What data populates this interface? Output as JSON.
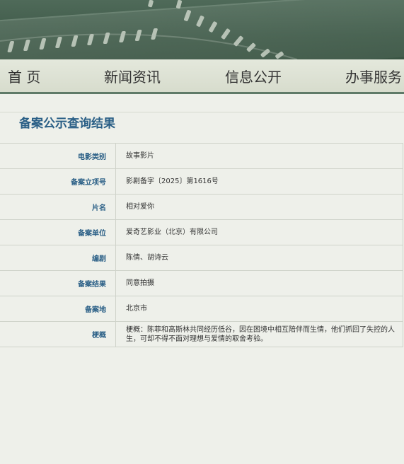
{
  "nav": {
    "items": [
      {
        "label": "首 页"
      },
      {
        "label": "新闻资讯"
      },
      {
        "label": "信息公开"
      },
      {
        "label": "办事服务"
      }
    ]
  },
  "page": {
    "title": "备案公示查询结果"
  },
  "record": {
    "rows": [
      {
        "label": "电影类别",
        "value": "故事影片"
      },
      {
        "label": "备案立项号",
        "value": "影剧备字〔2025〕第1616号"
      },
      {
        "label": "片名",
        "value": "相对爱你"
      },
      {
        "label": "备案单位",
        "value": "爱奇艺影业（北京）有限公司"
      },
      {
        "label": "编剧",
        "value": "陈倩、胡诗云"
      },
      {
        "label": "备案结果",
        "value": "同意拍摄"
      },
      {
        "label": "备案地",
        "value": "北京市"
      },
      {
        "label": "梗概",
        "value": "梗概：陈菲和高斯林共同经历低谷，因在困境中相互陪伴而生情，他们抓回了失控的人生，可却不得不面对理想与爱情的取舍考验。"
      }
    ]
  },
  "colors": {
    "banner": "#3f5a49",
    "accent": "#2a5f86",
    "nav_border": "#5f7a68"
  }
}
